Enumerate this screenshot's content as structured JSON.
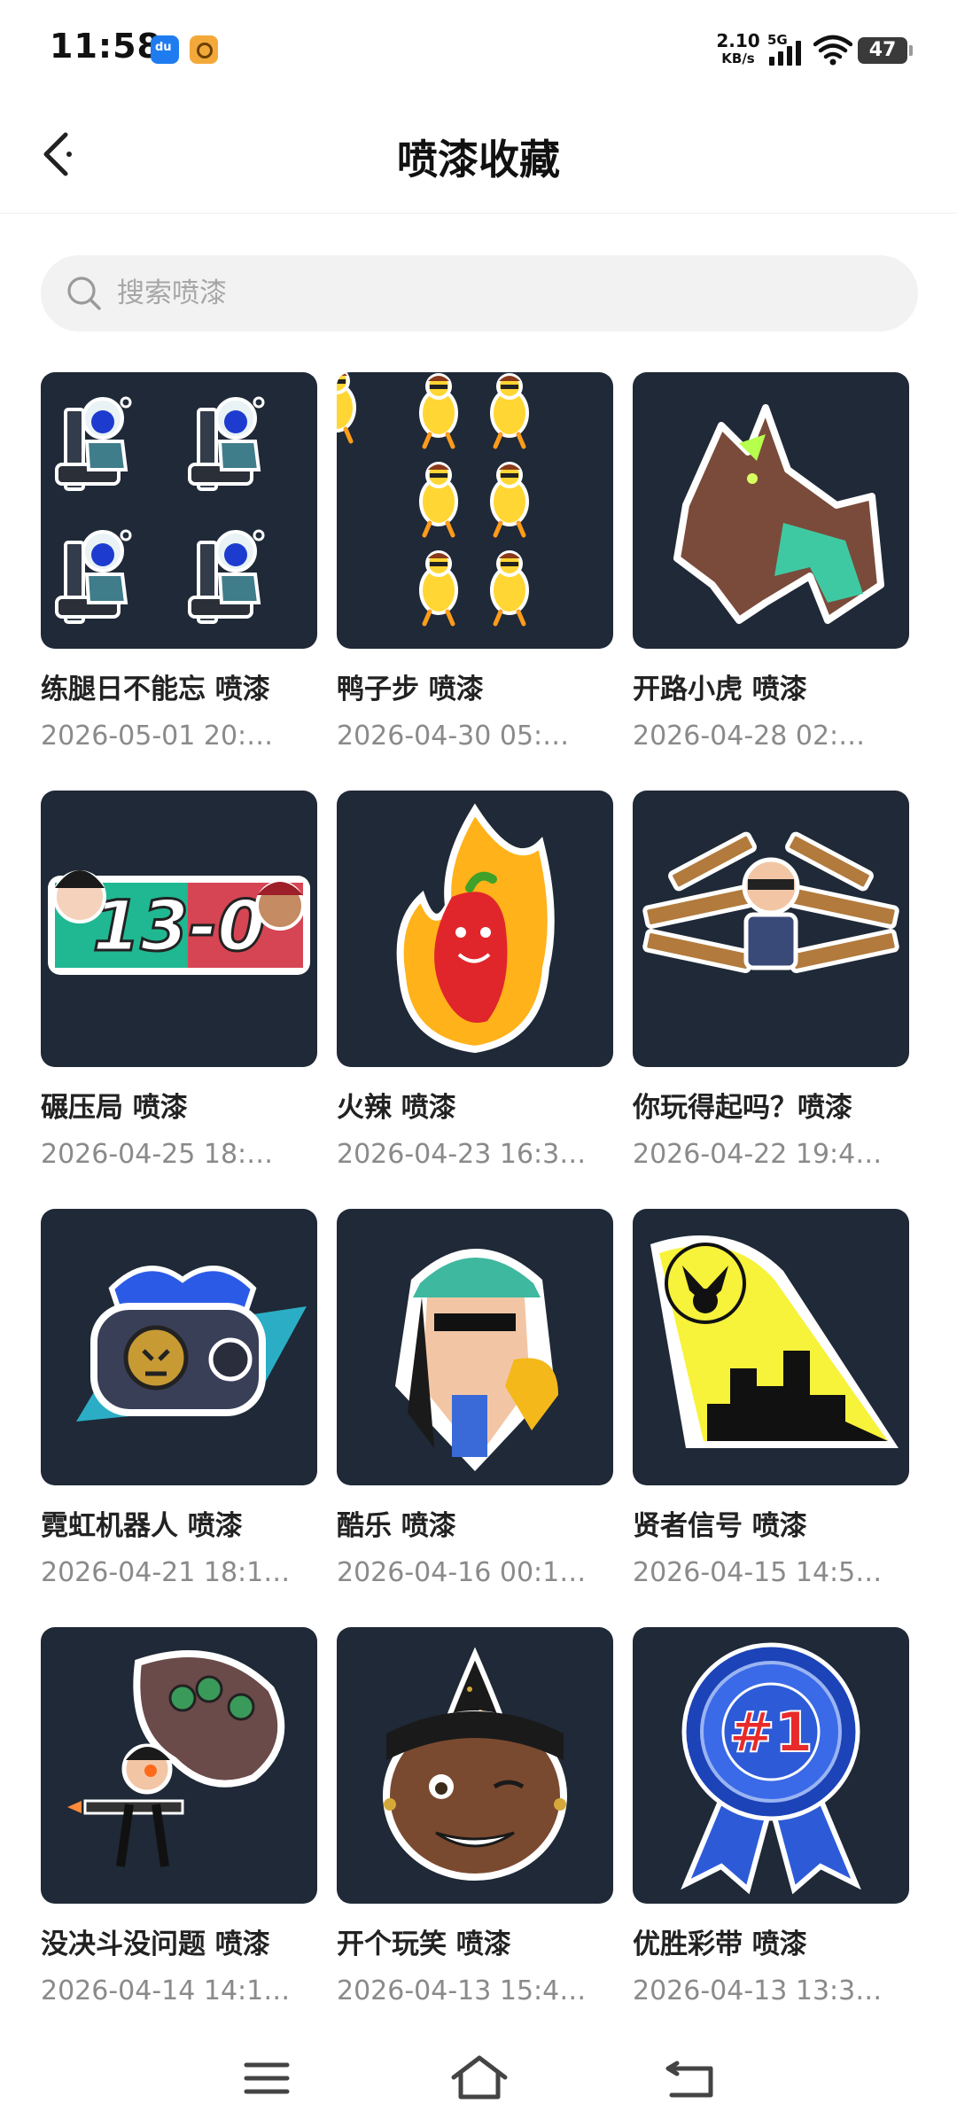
{
  "status_bar": {
    "time": "11:58",
    "app_icons": [
      "baidu-app-icon",
      "target-app-icon"
    ],
    "net_speed": "2.10",
    "net_speed_unit": "KB/s",
    "network": "5G",
    "battery": "47"
  },
  "header": {
    "title": "喷漆收藏",
    "back_icon": "chevron-left-icon"
  },
  "search": {
    "placeholder": "搜索喷漆",
    "value": ""
  },
  "items": [
    {
      "title": "练腿日不能忘 喷漆",
      "date": "2026-05-01 20:…"
    },
    {
      "title": "鸭子步 喷漆",
      "date": "2026-04-30 05:…"
    },
    {
      "title": "开路小虎 喷漆",
      "date": "2026-04-28 02:…"
    },
    {
      "title": "碾压局 喷漆",
      "date": "2026-04-25 18:…"
    },
    {
      "title": "火辣 喷漆",
      "date": "2026-04-23 16:3…"
    },
    {
      "title": "你玩得起吗？喷漆",
      "date": "2026-04-22 19:4…"
    },
    {
      "title": "霓虹机器人 喷漆",
      "date": "2026-04-21 18:1…"
    },
    {
      "title": "酷乐 喷漆",
      "date": "2026-04-16 00:1…"
    },
    {
      "title": "贤者信号 喷漆",
      "date": "2026-04-15 14:5…"
    },
    {
      "title": "没决斗没问题 喷漆",
      "date": "2026-04-14 14:1…"
    },
    {
      "title": "开个玩笑 喷漆",
      "date": "2026-04-13 15:4…"
    },
    {
      "title": "优胜彩带 喷漆",
      "date": "2026-04-13 13:3…"
    }
  ],
  "spray_art_text": {
    "score": "13-0",
    "ribbon": "#1"
  },
  "bottom_nav": {
    "icons": [
      "menu-icon",
      "home-icon",
      "back-icon"
    ]
  },
  "colors": {
    "thumb_bg": "#1f2937",
    "search_bg": "#f2f2f2",
    "date_text": "#8a8a8a"
  }
}
